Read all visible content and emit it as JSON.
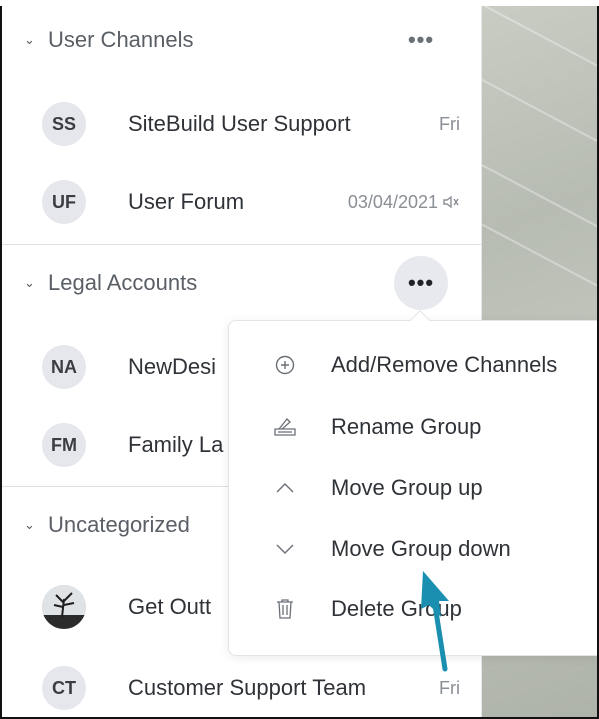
{
  "groups": [
    {
      "name": "User Channels",
      "more_label": "•••",
      "channels": [
        {
          "initials": "SS",
          "title": "SiteBuild User Support",
          "date": "Fri",
          "muted": false
        },
        {
          "initials": "UF",
          "title": "User Forum",
          "date": "03/04/2021",
          "muted": true
        }
      ]
    },
    {
      "name": "Legal Accounts",
      "more_label": "•••",
      "channels": [
        {
          "initials": "NA",
          "title": "NewDesi"
        },
        {
          "initials": "FM",
          "title": "Family La"
        }
      ]
    },
    {
      "name": "Uncategorized",
      "channels": [
        {
          "initials": "",
          "title": "Get Outt",
          "avatar": "photo"
        },
        {
          "initials": "CT",
          "title": "Customer Support Team",
          "date": "Fri"
        }
      ]
    }
  ],
  "context_menu": {
    "items": [
      {
        "label": "Add/Remove Channels",
        "icon": "plus-circle-icon"
      },
      {
        "label": "Rename Group",
        "icon": "rename-icon"
      },
      {
        "label": "Move Group up",
        "icon": "chevron-up-icon"
      },
      {
        "label": "Move Group down",
        "icon": "chevron-down-icon"
      },
      {
        "label": "Delete Group",
        "icon": "trash-icon"
      }
    ]
  },
  "colors": {
    "avatar_bg": "#e6e7ec",
    "active_more_bg": "#e8e9ee",
    "arrow": "#1a8fb0"
  }
}
